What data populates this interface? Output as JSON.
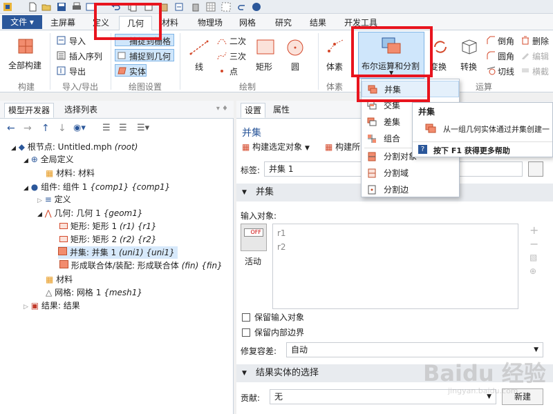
{
  "menu": {
    "file": "文件 ▾",
    "tabs": [
      "主屏幕",
      "定义",
      "几何",
      "材料",
      "物理场",
      "网格",
      "研究",
      "结果",
      "开发工具"
    ],
    "active_tab": "几何"
  },
  "ribbon": {
    "build_all": "全部构建",
    "group_build": "构建",
    "import": "导入",
    "insert_sequence": "插入序列",
    "export": "导出",
    "group_import_export": "导入/导出",
    "snap_grid": "捕捉到栅格",
    "snap_geometry": "捕捉到几何",
    "solid": "实体",
    "group_draw_settings": "绘图设置",
    "line": "线",
    "quadratic": "二次",
    "cubic": "三次",
    "point": "点",
    "rectangle": "矩形",
    "circle": "圆",
    "group_draw": "绘制",
    "primitives": "体素",
    "group_primitives": "体素",
    "boolean_partition": "布尔运算和分割",
    "transform": "变换",
    "convert": "转换",
    "fillet": "倒角",
    "round": "圆角",
    "tangent": "切线",
    "delete": "删除",
    "edit_vertex": "编辑",
    "cut": "横截",
    "group_operations": "运算"
  },
  "dropdown": {
    "items": [
      "并集",
      "交集",
      "差集",
      "组合",
      "分割对象",
      "分割域",
      "分割边"
    ]
  },
  "tooltip": {
    "title": "并集",
    "description": "从一组几何实体通过并集创建一",
    "help": "按下 F1 获得更多帮助"
  },
  "left_panel": {
    "tabs": [
      "模型开发器",
      "选择列表"
    ],
    "tree": {
      "root_label": "根节点: Untitled.mph",
      "root_tag": "(root)",
      "global_defs": "全局定义",
      "materials_global": "材料: 材料",
      "component_label": "组件: 组件 1",
      "component_tag": "{comp1} {comp1}",
      "definitions": "定义",
      "geometry_label": "几何: 几何 1",
      "geometry_tag": "{geom1}",
      "rect1_label": "矩形: 矩形 1",
      "rect1_tag": "(r1) {r1}",
      "rect2_label": "矩形: 矩形 2",
      "rect2_tag": "(r2) {r2}",
      "union_label": "并集: 并集 1",
      "union_tag": "(uni1) {uni1}",
      "form_union_label": "形成联合体/装配: 形成联合体",
      "form_union_tag": "(fin) {fin}",
      "materials": "材料",
      "mesh_label": "网格: 网格 1",
      "mesh_tag": "{mesh1}",
      "results": "结果: 结果"
    }
  },
  "right_panel": {
    "tabs": [
      "设置",
      "属性"
    ],
    "title": "并集",
    "build_selected": "构建选定对象",
    "build_all": "构建所",
    "label_caption": "标签:",
    "label_value": "并集 1",
    "section_union": "并集",
    "input_objects_caption": "输入对象:",
    "input_objects": [
      "r1",
      "r2"
    ],
    "toggle_off": "OFF",
    "active_caption": "活动",
    "keep_input": "保留输入对象",
    "keep_interior": "保留内部边界",
    "repair_tol_caption": "修复容差:",
    "repair_tol_value": "自动",
    "section_result": "结果实体的选择",
    "contribute_caption": "贡献:",
    "contribute_value": "无",
    "new_button": "新建"
  },
  "watermark": {
    "brand": "Baidu 经验",
    "url": "jingyan.baidu.com"
  },
  "colors": {
    "accent": "#2b579a",
    "highlight_red": "#e8141e",
    "selected_bg": "#cfe6fb",
    "shape_fill": "#f28c6e"
  }
}
